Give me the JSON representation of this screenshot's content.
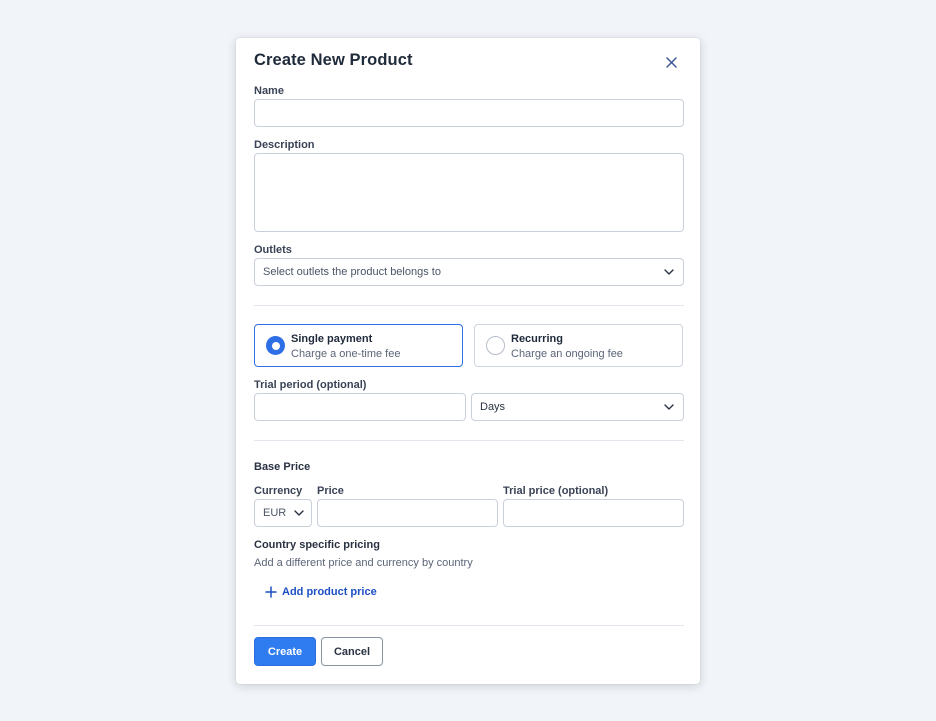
{
  "modal": {
    "title": "Create New Product",
    "close_icon": "close-icon"
  },
  "fields": {
    "name": {
      "label": "Name",
      "value": ""
    },
    "description": {
      "label": "Description",
      "value": ""
    },
    "outlets": {
      "label": "Outlets",
      "placeholder": "Select outlets the product belongs to"
    }
  },
  "payment_type": {
    "selected": "single",
    "options": [
      {
        "title": "Single payment",
        "subtitle": "Charge a one-time fee"
      },
      {
        "title": "Recurring",
        "subtitle": "Charge an ongoing fee"
      }
    ]
  },
  "trial": {
    "label": "Trial period (optional)",
    "value": "",
    "unit": "Days"
  },
  "base_price": {
    "title": "Base Price",
    "currency_label": "Currency",
    "currency_value": "EUR",
    "price_label": "Price",
    "price_value": "",
    "trial_price_label": "Trial price (optional)",
    "trial_price_value": ""
  },
  "country_pricing": {
    "title": "Country specific pricing",
    "description": "Add a different price and currency by country",
    "add_label": "Add product price"
  },
  "actions": {
    "create_label": "Create",
    "cancel_label": "Cancel"
  },
  "colors": {
    "accent": "#2f7cf0",
    "link": "#1d4fc4",
    "background": "#f1f4f8"
  }
}
